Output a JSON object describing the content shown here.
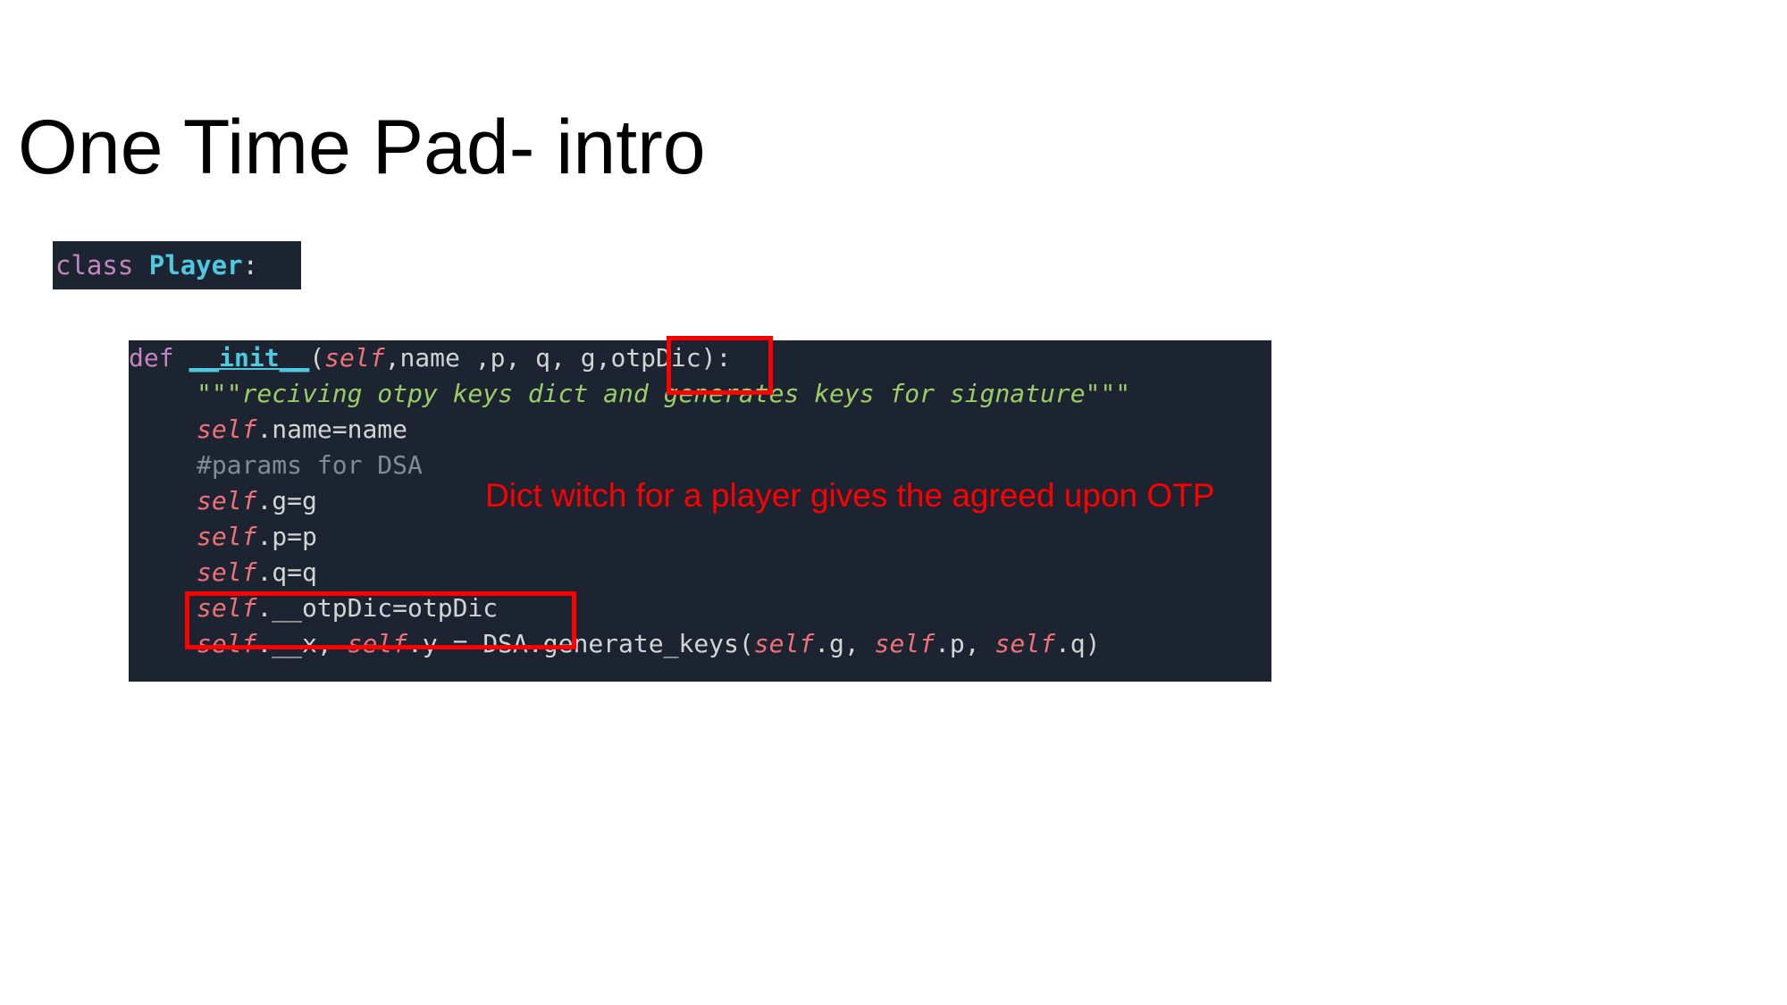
{
  "slide": {
    "title": "One Time Pad- intro"
  },
  "class_snippet": {
    "keyword": "class",
    "name": "Player",
    "colon": ":"
  },
  "code": {
    "lines": [
      "def __init__(self,name ,p, q, g,otpDic):",
      "\"\"\"reciving otpy keys dict and generates keys for signature\"\"\"",
      "self.name=name",
      "#params for DSA",
      "self.g=g",
      "self.p=p",
      "self.q=q",
      "self.__otpDic=otpDic",
      "self.__x, self.y = DSA.generate_keys(self.g, self.p, self.q)"
    ]
  },
  "annotation": {
    "text": "Dict witch for a player gives the agreed upon OTP",
    "color": "#ff0000"
  },
  "colors": {
    "code_background": "#1b2430",
    "highlight": "#ff0000",
    "keyword": "#c586c0",
    "self": "#f07178",
    "docstring": "#9ccc65",
    "comment": "#7f8c98"
  }
}
